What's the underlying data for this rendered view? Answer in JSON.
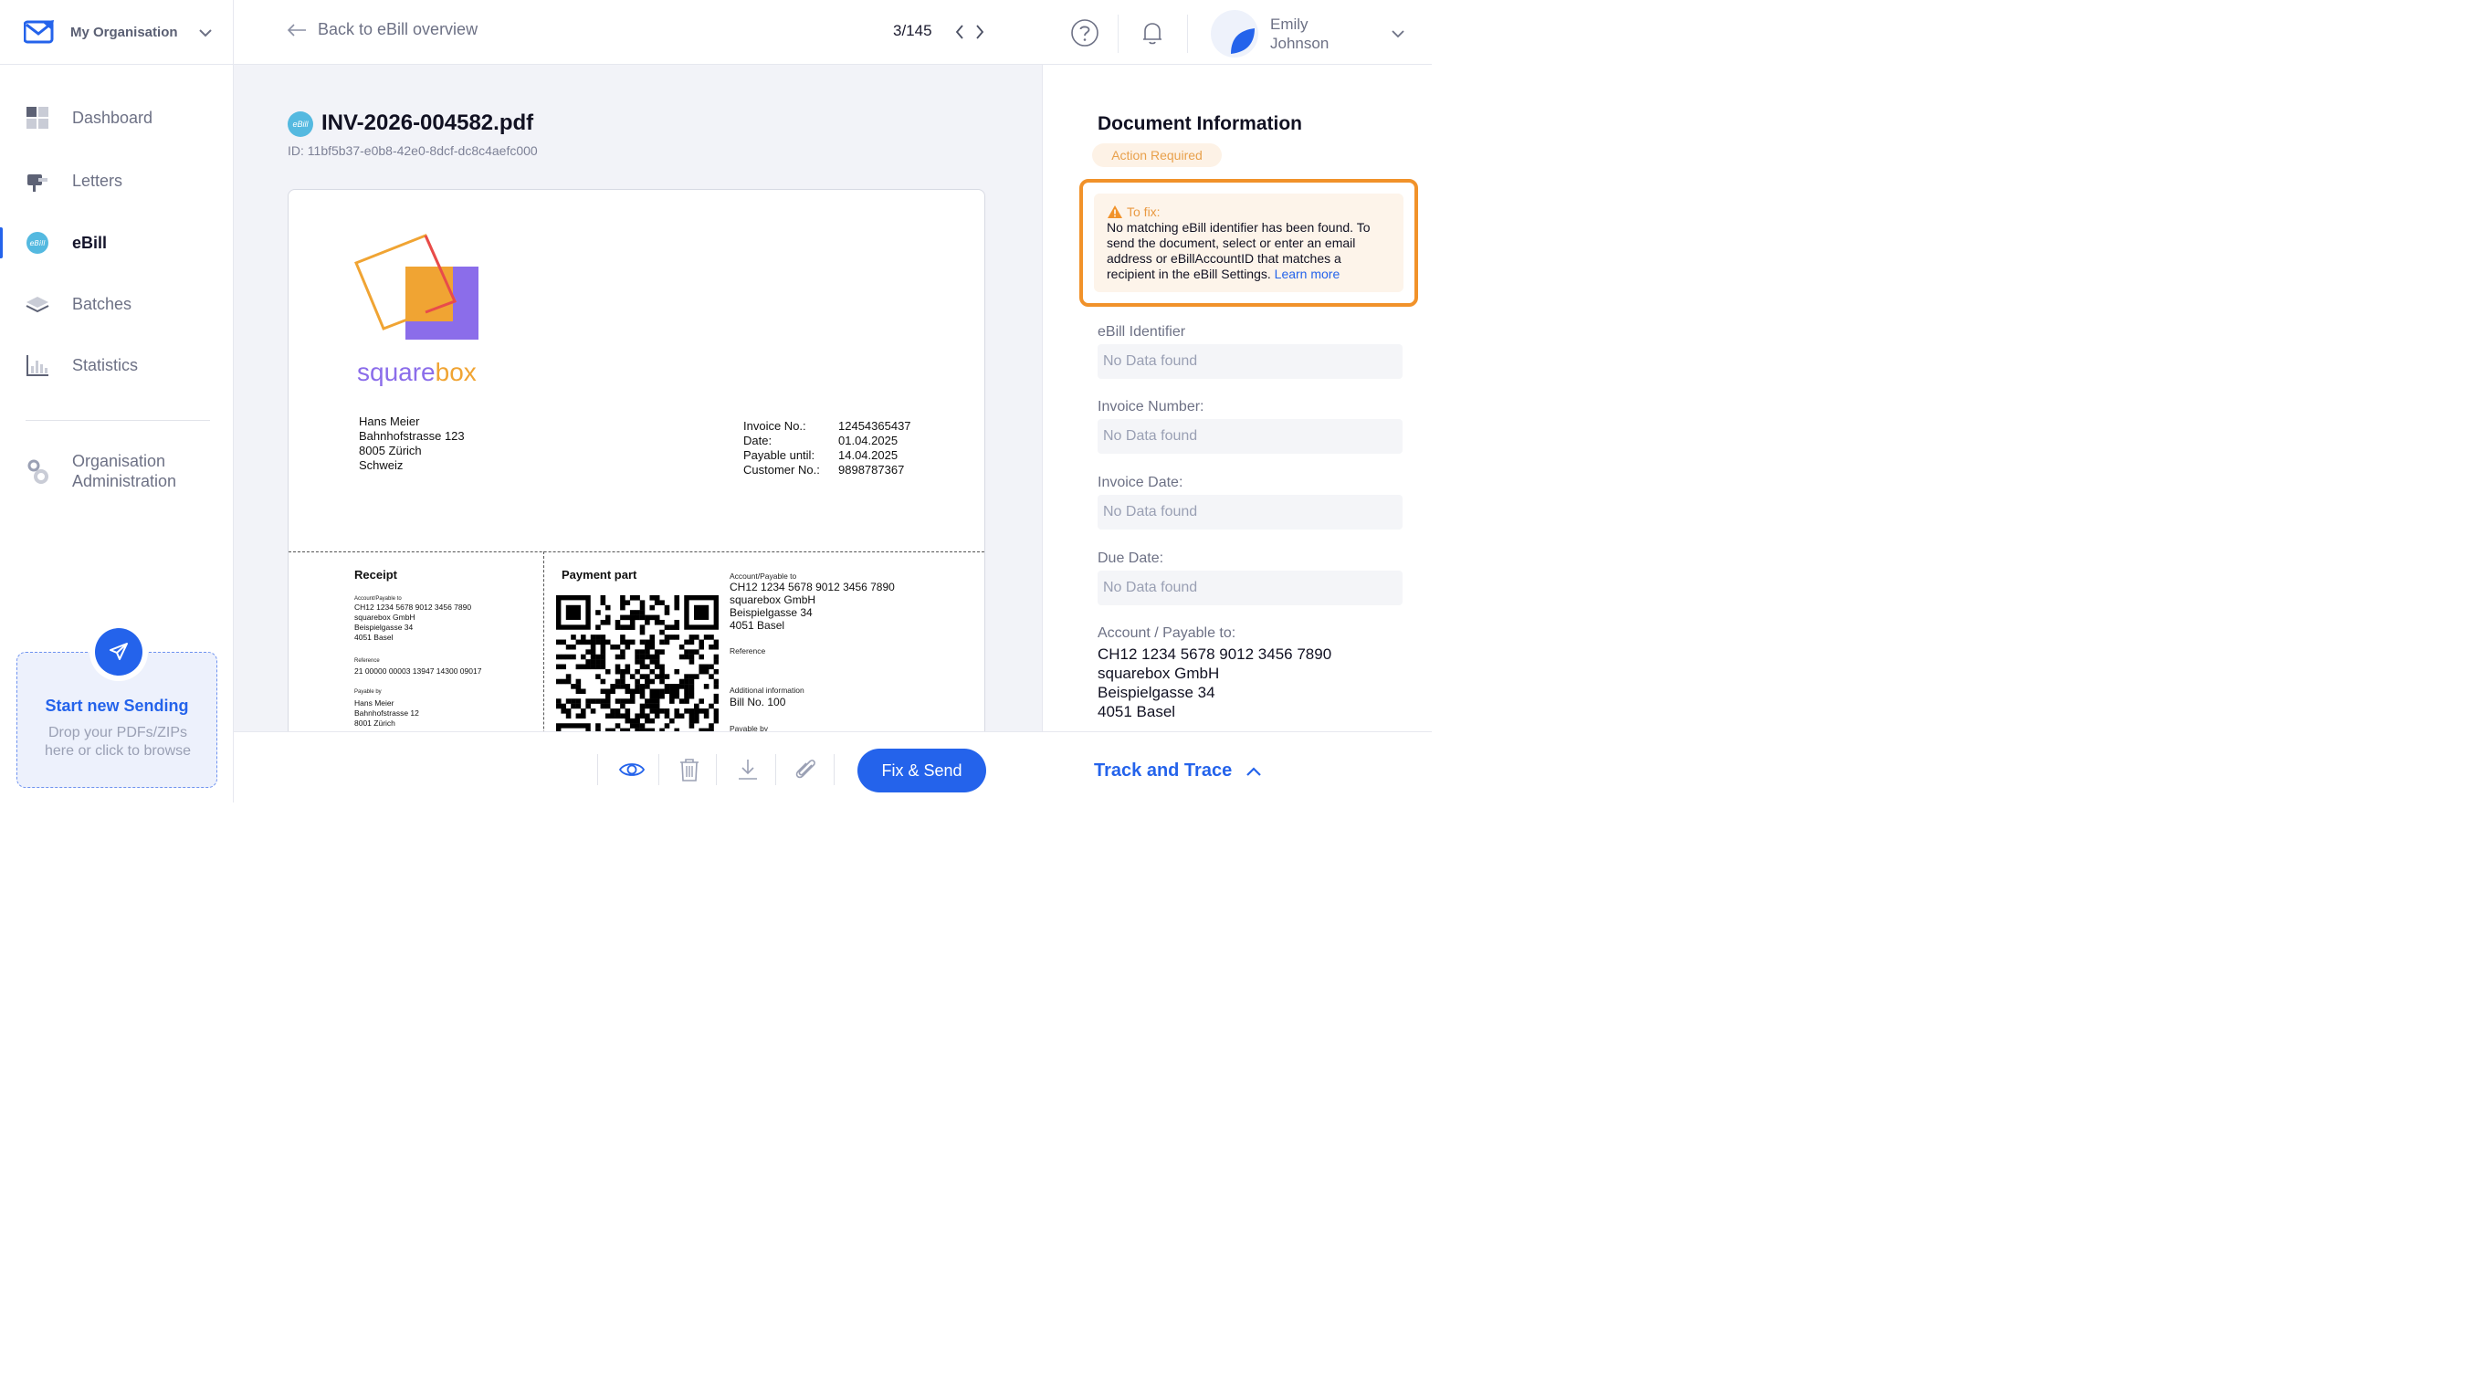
{
  "org": {
    "name": "My Organisation"
  },
  "nav": {
    "items": [
      {
        "label": "Dashboard",
        "icon": "dashboard-icon"
      },
      {
        "label": "Letters",
        "icon": "mailbox-icon"
      },
      {
        "label": "eBill",
        "icon": "ebill-icon",
        "active": true
      },
      {
        "label": "Batches",
        "icon": "layers-icon"
      },
      {
        "label": "Statistics",
        "icon": "bar-chart-icon"
      }
    ],
    "admin_line1": "Organisation",
    "admin_line2": "Administration"
  },
  "send": {
    "title": "Start new Sending",
    "sub_line1": "Drop your PDFs/ZIPs",
    "sub_line2": "here or click to browse"
  },
  "topbar": {
    "back_label": "Back to eBill overview",
    "pager": "3/145",
    "user_first": "Emily",
    "user_last": "Johnson"
  },
  "document": {
    "badge": "eBill",
    "title": "INV-2026-004582.pdf",
    "id_text": "ID: 11bf5b37-e0b8-42e0-8dcf-dc8c4aefc000"
  },
  "invoice": {
    "brand_part1": "square",
    "brand_part2": "box",
    "recipient": [
      "Hans Meier",
      "Bahnhofstrasse 123",
      "8005 Zürich",
      "Schweiz"
    ],
    "keys": [
      "Invoice No.:",
      "Date:",
      "Payable until:",
      "Customer No.:"
    ],
    "values": [
      "12454365437",
      "01.04.2025",
      "14.04.2025",
      "9898787367"
    ],
    "receipt": {
      "heading": "Receipt",
      "account_label": "Account/Payable to",
      "account_lines": [
        "CH12 1234 5678 9012 3456 7890",
        "squarebox GmbH",
        "Beispielgasse 34",
        "4051 Basel"
      ],
      "reference_label": "Reference",
      "reference": "21 00000 00003 13947 14300 09017",
      "payable_by_label": "Payable by",
      "payable_by_lines": [
        "Hans Meier",
        "Bahnhofstrasse 12",
        "8001 Zürich"
      ]
    },
    "payment": {
      "heading": "Payment part",
      "account_label": "Account/Payable to",
      "account_lines": [
        "CH12 1234 5678 9012 3456 7890",
        "squarebox GmbH",
        "Beispielgasse 34",
        "4051 Basel"
      ],
      "reference_label": "Reference",
      "additional_label": "Additional information",
      "additional": "Bill No. 100",
      "payable_by_label": "Payable by"
    }
  },
  "toolbar": {
    "fix_send": "Fix & Send",
    "track": "Track and Trace"
  },
  "panel": {
    "title": "Document Information",
    "status": "Action Required",
    "fix_head": "To fix:",
    "fix_body": "No matching eBill identifier has been found. To send the document, select or enter an email address or eBillAccountID that matches a recipient in the eBill Settings.",
    "learn_more": "Learn more",
    "fields": [
      {
        "label": "eBill Identifier",
        "value": "No Data found"
      },
      {
        "label": "Invoice Number:",
        "value": "No Data found"
      },
      {
        "label": "Invoice Date:",
        "value": "No Data found"
      },
      {
        "label": "Due Date:",
        "value": "No Data found"
      }
    ],
    "account_label": "Account / Payable to:",
    "account_lines": [
      "CH12 1234 5678 9012 3456 7890",
      "squarebox GmbH",
      "Beispielgasse 34",
      "4051 Basel"
    ]
  },
  "colors": {
    "accent": "#2463eb",
    "warning": "#f1922a",
    "ebill": "#54b9e0"
  }
}
